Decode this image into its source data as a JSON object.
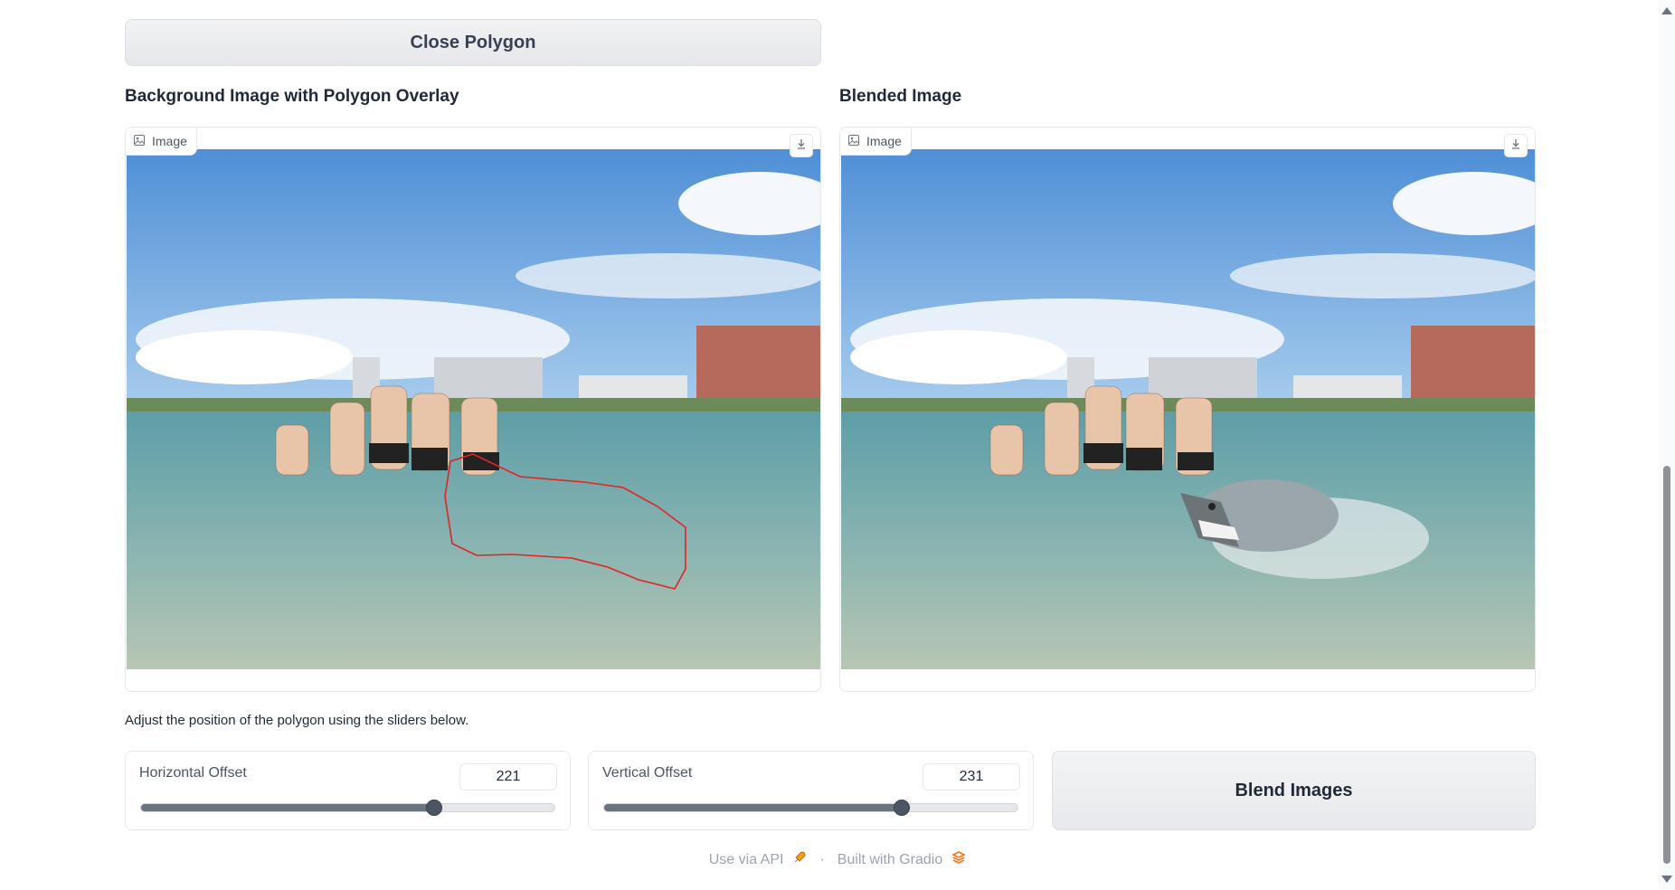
{
  "close_polygon_button": "Close Polygon",
  "left_panel": {
    "title": "Background Image with Polygon Overlay",
    "tag": "Image",
    "download_icon": "download-icon"
  },
  "right_panel": {
    "title": "Blended Image",
    "tag": "Image",
    "download_icon": "download-icon"
  },
  "hint": "Adjust the position of the polygon using the sliders below.",
  "horizontal_slider": {
    "label": "Horizontal Offset",
    "value": "221",
    "fraction": 0.71
  },
  "vertical_slider": {
    "label": "Vertical Offset",
    "value": "231",
    "fraction": 0.72
  },
  "blend_button": "Blend Images",
  "footer": {
    "api": "Use via API",
    "built": "Built with Gradio",
    "separator": "·"
  },
  "colors": {
    "polygon": "#e02424",
    "slider_fill": "#6b7280"
  }
}
